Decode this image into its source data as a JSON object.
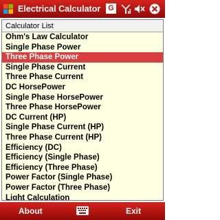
{
  "window": {
    "title": "Electrical Calculator",
    "badge_letter": "G",
    "icons": [
      "windows-logo-icon",
      "signal-icon",
      "volume-icon",
      "close-icon"
    ]
  },
  "list": {
    "header": "Calculator List",
    "selected_index": 2,
    "items": [
      "Ohm's Law Calculator",
      "Single Phase Power",
      "Three Phase Power",
      "Single Phase Current",
      "Three Phase Current",
      "DC HorsePower",
      "Single Phase HorsePower",
      "Three Phase HorsePower",
      "DC Current (HP)",
      "Single Phase Current (HP)",
      "Three Phase Current (HP)",
      "Efficiency (DC)",
      "Efficiency (Single Phase)",
      "Efficiency (Three Phase)",
      "Power Factor (Single Phase)",
      "Power Factor (Three Phase)",
      "Light Calculation"
    ]
  },
  "menu": {
    "left_label": "About",
    "right_label": "Exit",
    "center_icon": "keyboard-icon"
  },
  "colors": {
    "bar_red": "#b3140f",
    "list_background": "#ffffe1",
    "selection": "#d93f3f"
  }
}
